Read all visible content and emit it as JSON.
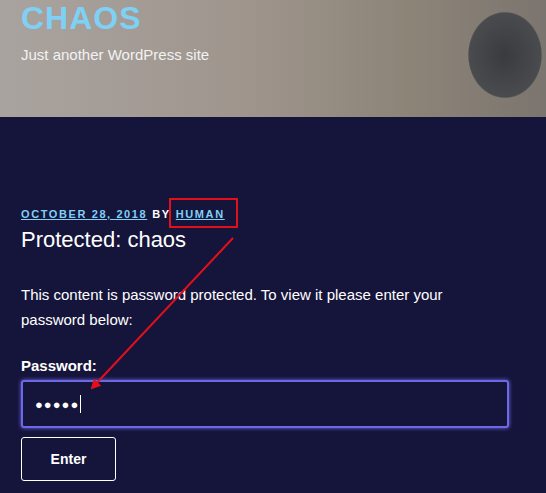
{
  "site": {
    "title": "CHAOS",
    "tagline": "Just another WordPress site"
  },
  "post": {
    "date": "OCTOBER 28, 2018",
    "by": "BY",
    "author": "HUMAN",
    "title": "Protected: chaos",
    "message": "This content is password protected. To view it please enter your password below:"
  },
  "form": {
    "label": "Password:",
    "value": "●●●●●",
    "focused": true,
    "button": "Enter"
  }
}
